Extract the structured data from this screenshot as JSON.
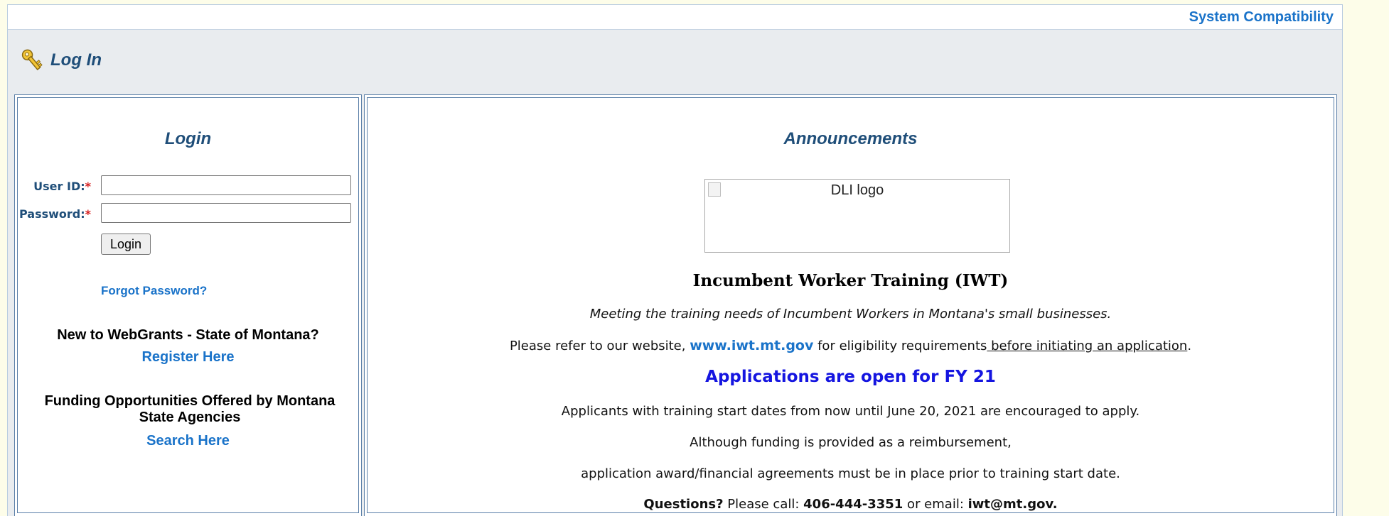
{
  "header": {
    "system_compatibility": "System Compatibility",
    "page_title": "Log In"
  },
  "login": {
    "heading": "Login",
    "user_id_label": "User ID:",
    "password_label": "Password:",
    "required_mark": "*",
    "user_id_value": "",
    "password_value": "",
    "login_button": "Login",
    "forgot_password": "Forgot Password?",
    "new_prompt": "New to WebGrants - State of Montana?",
    "register_link": "Register Here",
    "funding_prompt": "Funding Opportunities Offered by Montana State Agencies",
    "search_link": "Search Here"
  },
  "announcements": {
    "heading": "Announcements",
    "logo_alt": "DLI logo",
    "program_title": "Incumbent Worker Training (IWT)",
    "tagline": "Meeting the training needs of Incumbent Workers in Montana's small businesses.",
    "refer_prefix": "Please refer to our website, ",
    "website": "www.iwt.mt.gov",
    "refer_middle": " for eligibility requirements",
    "refer_underlined": " before initiating an application",
    "refer_suffix": ".",
    "open_notice": "Applications are open for FY 21",
    "line1": "Applicants with training start dates from now until June 20, 2021 are encouraged to apply.",
    "line2": "Although funding is provided as a reimbursement,",
    "line3": "application award/financial agreements must be in place prior to training start date.",
    "questions_label": "Questions?",
    "call_text": " Please call: ",
    "phone": "406-444-3351",
    "email_text": " or email: ",
    "email": "iwt@mt.gov."
  },
  "colors": {
    "link_blue": "#1a73c9",
    "heading_navy": "#1f4e79",
    "notice_blue": "#1515e0",
    "required_red": "#d61f1f",
    "page_background": "#fdfde9"
  },
  "icons": {
    "title_icon": "key-icon"
  }
}
